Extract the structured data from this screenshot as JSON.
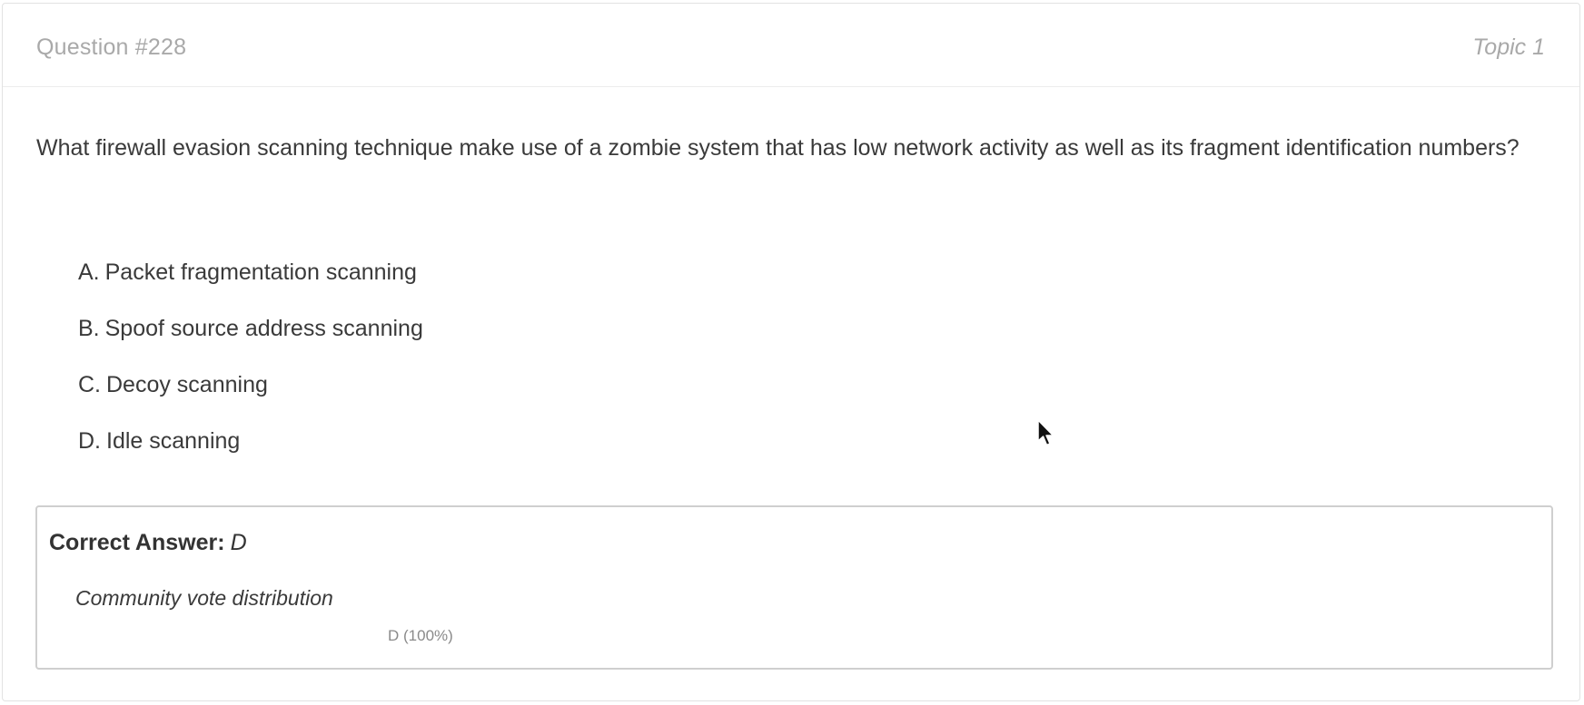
{
  "question": {
    "number_label": "Question #228",
    "topic_label": "Topic 1",
    "text": "What firewall evasion scanning technique make use of a zombie system that has low network activity as well as its fragment identification numbers?",
    "choices": [
      {
        "letter": "A.",
        "text": "Packet fragmentation scanning"
      },
      {
        "letter": "B.",
        "text": "Spoof source address scanning"
      },
      {
        "letter": "C.",
        "text": "Decoy scanning"
      },
      {
        "letter": "D.",
        "text": "Idle scanning"
      }
    ]
  },
  "answer": {
    "label": "Correct Answer:",
    "value": "D",
    "vote_title": "Community vote distribution",
    "vote_label": "D (100%)",
    "vote_percent": 100
  },
  "colors": {
    "text": "#3a3a3a",
    "muted": "#a9a9a9",
    "border": "#cfcfcf"
  },
  "icons": {
    "cursor": "mouse-pointer-icon"
  }
}
